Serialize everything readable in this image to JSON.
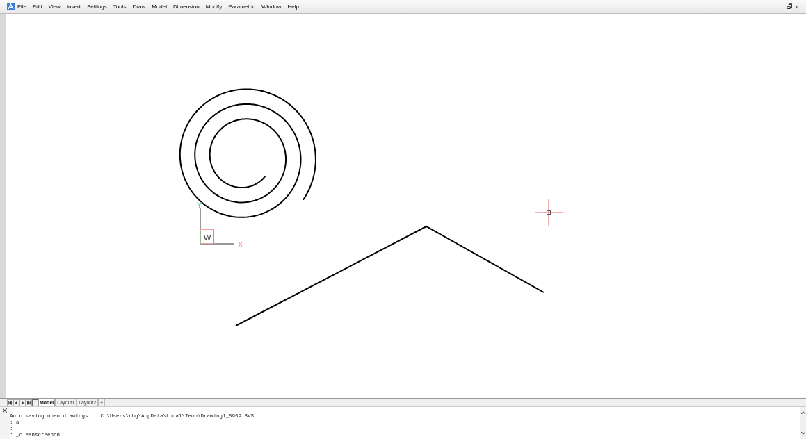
{
  "menu": [
    "File",
    "Edit",
    "View",
    "Insert",
    "Settings",
    "Tools",
    "Draw",
    "Model",
    "Dimension",
    "Modify",
    "Parametric",
    "Window",
    "Help"
  ],
  "window_controls": [
    "_",
    "🗗",
    "×"
  ],
  "ucs_icon": {
    "y_label": "Y",
    "w_label": "W",
    "x_label": "X"
  },
  "layout_tabs": [
    {
      "label": "Model",
      "selected": true
    },
    {
      "label": "Layout1",
      "selected": false
    },
    {
      "label": "Layout2",
      "selected": false
    },
    {
      "label": "+",
      "selected": false
    }
  ],
  "command_history": [
    "Auto saving open drawings... C:\\Users\\rhg\\AppData\\Local\\Temp\\Drawing1_5959.SV$",
    ": a",
    ":",
    ": _cleanscreenon"
  ]
}
